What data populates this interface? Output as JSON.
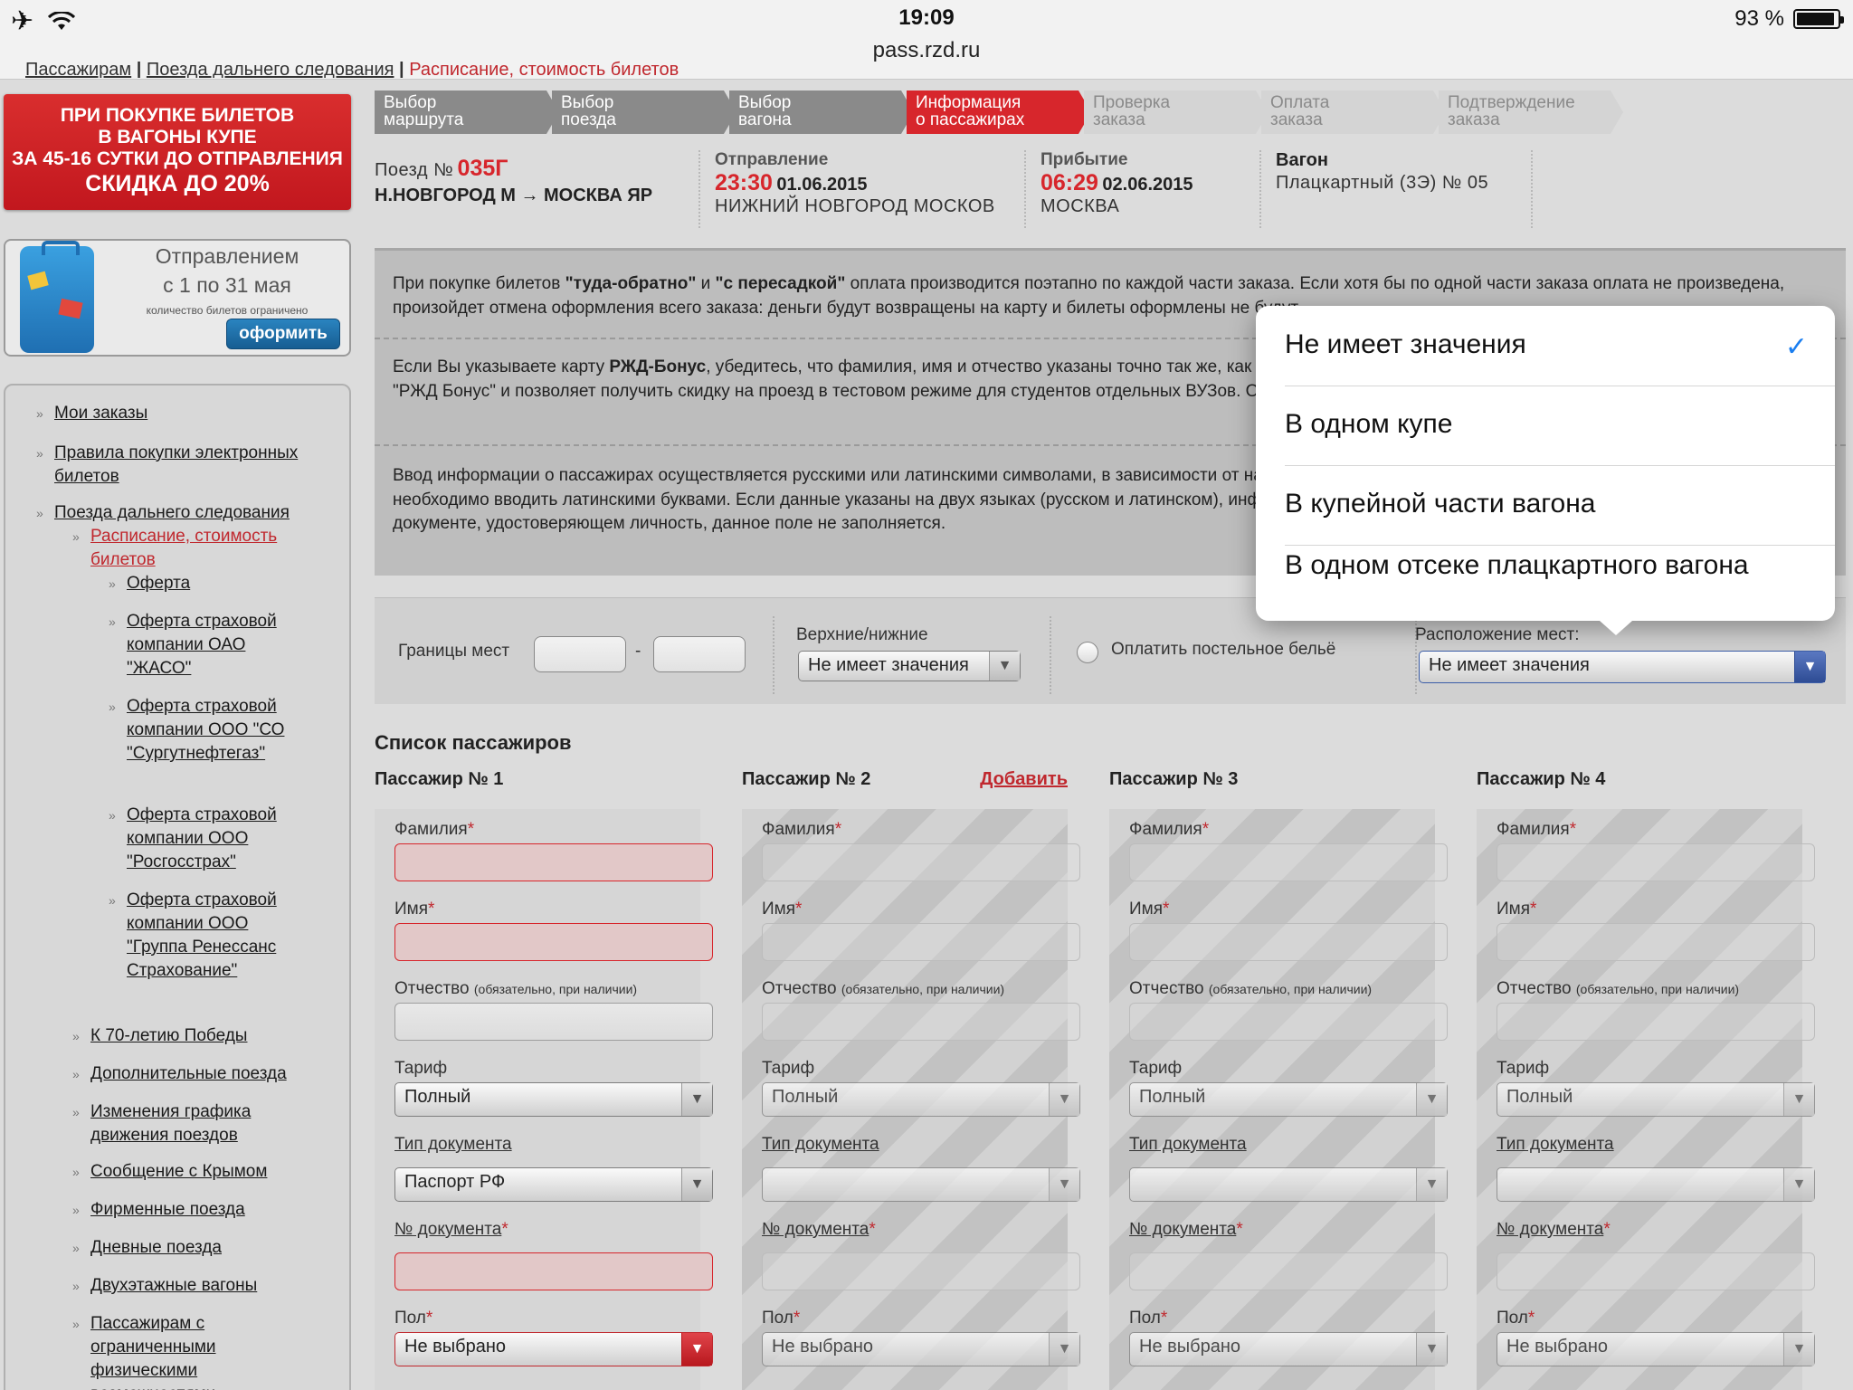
{
  "status": {
    "time": "19:09",
    "url": "pass.rzd.ru",
    "battery": "93 %",
    "battery_level": 0.93
  },
  "breadcrumb": {
    "part1": "Пассажирам",
    "sep": " | ",
    "part2": "Поезда дальнего следования",
    "part3": "Расписание, стоимость билетов"
  },
  "promo": {
    "line1": "ПРИ ПОКУПКЕ БИЛЕТОВ",
    "line2": "В ВАГОНЫ КУПЕ",
    "line3": "ЗА 45-16 СУТКИ ДО ОТПРАВЛЕНИЯ",
    "line4": "СКИДКА ДО 20%"
  },
  "promo2": {
    "line1": "Отправлением",
    "line2": "с 1 по 31 мая",
    "line3": "количество билетов ограничено",
    "button": "оформить"
  },
  "nav": {
    "my_orders": "Мои заказы",
    "rules": "Правила покупки электронных билетов",
    "long_distance": "Поезда дальнего следования",
    "schedule": "Расписание, стоимость билетов",
    "offer": "Оферта",
    "offer_zhaso": "Оферта страховой компании ОАО \"ЖАСО\"",
    "offer_surgut": "Оферта страховой компании ООО \"СО \"Сургутнефтегаз\"",
    "offer_rosgos": "Оферта страховой компании ООО \"Росгосстрах\"",
    "offer_renaissance": "Оферта страховой компании ООО \"Группа Ренессанс Страхование\"",
    "victory": "К 70-летию Победы",
    "extra_trains": "Дополнительные поезда",
    "schedule_changes": "Изменения графика движения поездов",
    "crimea": "Сообщение с Крымом",
    "branded": "Фирменные поезда",
    "day_trains": "Дневные поезда",
    "double_decker": "Двухэтажные вагоны",
    "disabled": "Пассажирам с ограниченными физическими возможностями"
  },
  "steps": [
    {
      "l1": "Выбор",
      "l2": "маршрута"
    },
    {
      "l1": "Выбор",
      "l2": "поезда"
    },
    {
      "l1": "Выбор",
      "l2": "вагона"
    },
    {
      "l1": "Информация",
      "l2": "о пассажирах"
    },
    {
      "l1": "Проверка",
      "l2": "заказа"
    },
    {
      "l1": "Оплата",
      "l2": "заказа"
    },
    {
      "l1": "Подтверждение",
      "l2": "заказа"
    }
  ],
  "train": {
    "label": "Поезд №",
    "number": "035Г",
    "route": "Н.НОВГОРОД М → МОСКВА ЯР",
    "dep_label": "Отправление",
    "dep_time": "23:30",
    "dep_date": "01.06.2015",
    "dep_station": "НИЖНИЙ НОВГОРОД МОСКОВ",
    "arr_label": "Прибытие",
    "arr_time": "06:29",
    "arr_date": "02.06.2015",
    "arr_station": "МОСКВА",
    "car_label": "Вагон",
    "car_value": "Плацкартный (3Э) № 05"
  },
  "info": {
    "p1a": "При покупке билетов ",
    "p1b": "\"туда-обратно\"",
    "p1c": " и ",
    "p1d": "\"с пересадкой\"",
    "p1e": " оплата производится поэтапно по каждой части заказа. Если хотя бы по одной части заказа оплата не произведена, произойдет отмена оформления всего заказа: деньги будут возвращены на карту и билеты оформлены не будут.",
    "p2a": "Если Вы указываете карту ",
    "p2b": "РЖД-Бонус",
    "p2c": ", убедитесь, что фамилия, имя и отчество указаны точно так же, как в программе. Поле заполняется владельцами \"Студенческих карт \"РЖД Бонус\" и позволяет получить скидку на проезд в тестовом режиме для студентов отдельных ВУЗов. О полном запуске проекта будет сообщено дополнительно.",
    "p3": "Ввод информации о пассажирах осуществляется русскими или латинскими символами, в зависимости от написания в документах, удостоверяющих личность. Римские цифры необходимо вводить латинскими буквами. Если данные указаны на двух языках (русском и латинском), информация в заказе заполняется на русском. Если отчество не указано в документе, удостоверяющем личность, данное поле не заполняется."
  },
  "filters": {
    "seat_range": "Границы мест",
    "dash": "-",
    "upper_lower": "Верхние/нижние",
    "upper_lower_value": "Не имеет значения",
    "bedding": "Оплатить постельное бельё",
    "placement": "Расположение мест:",
    "placement_value": "Не имеет значения"
  },
  "dropdown": {
    "options": [
      "Не имеет значения",
      "В одном купе",
      "В купейной части вагона",
      "В одном отсеке плацкартного вагона"
    ],
    "check": "✓"
  },
  "passengers": {
    "title": "Список пассажиров",
    "add": "Добавить",
    "labels": {
      "surname": "Фамилия",
      "name": "Имя",
      "patronymic": "Отчество",
      "patronymic_note": "(обязательно, при наличии)",
      "tariff": "Тариф",
      "doc_type": "Тип документа",
      "doc_no": "№ документа",
      "gender": "Пол",
      "star": "*"
    },
    "list": [
      {
        "title": "Пассажир № 1",
        "tariff": "Полный",
        "doc_type": "Паспорт РФ",
        "gender": "Не выбрано"
      },
      {
        "title": "Пассажир № 2",
        "tariff": "Полный",
        "doc_type": "",
        "gender": "Не выбрано"
      },
      {
        "title": "Пассажир № 3",
        "tariff": "Полный",
        "doc_type": "",
        "gender": "Не выбрано"
      },
      {
        "title": "Пассажир № 4",
        "tariff": "Полный",
        "doc_type": "",
        "gender": "Не выбрано"
      }
    ]
  }
}
